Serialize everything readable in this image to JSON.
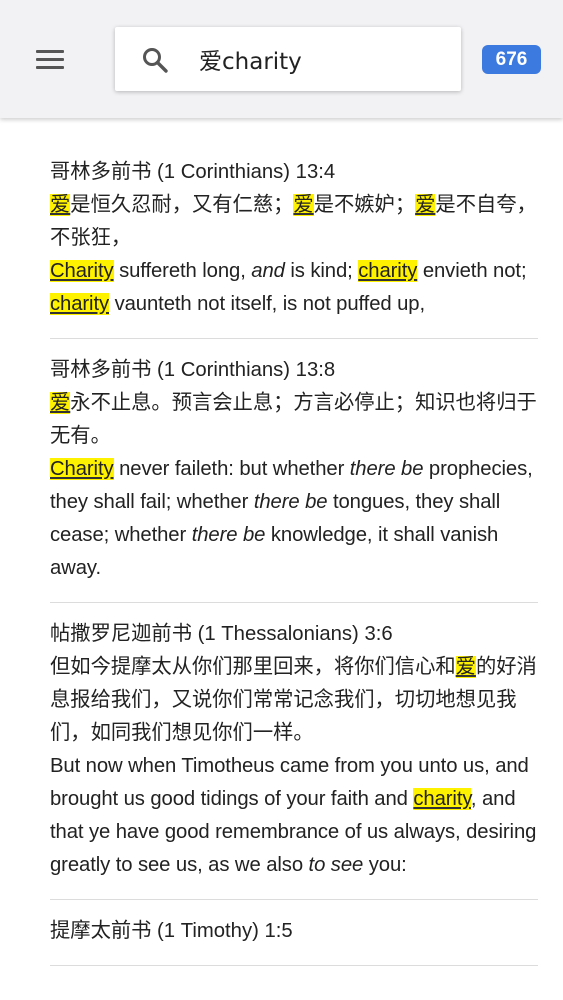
{
  "search": {
    "query": "爱charity"
  },
  "result_count": "676",
  "icons": {
    "menu": "hamburger-menu-icon",
    "search": "magnifier-search-icon"
  },
  "colors": {
    "highlight": "#fff200",
    "badge": "#3d7ae0",
    "topbar": "#f2f2f4"
  },
  "results": [
    {
      "reference": "哥林多前书 (1 Corinthians) 13:4",
      "chinese": [
        {
          "t": "爱",
          "hl": true
        },
        {
          "t": "是恒久忍耐，又有仁慈；"
        },
        {
          "t": "爱",
          "hl": true
        },
        {
          "t": "是不嫉妒；"
        },
        {
          "t": "爱",
          "hl": true
        },
        {
          "t": "是不自夸，不张狂，"
        }
      ],
      "english": [
        {
          "t": "Charity",
          "hl": true
        },
        {
          "t": " suffereth long, "
        },
        {
          "t": "and",
          "i": true
        },
        {
          "t": " is kind; "
        },
        {
          "t": "charity",
          "hl": true
        },
        {
          "t": " envi­eth not; "
        },
        {
          "t": "charity",
          "hl": true
        },
        {
          "t": " vaunteth not itself, is not puffed up,"
        }
      ]
    },
    {
      "reference": "哥林多前书 (1 Corinthians) 13:8",
      "chinese": [
        {
          "t": "爱",
          "hl": true
        },
        {
          "t": "永不止息。预言会止息；方言必停止；知识也将归于无有。"
        }
      ],
      "english": [
        {
          "t": "Charity",
          "hl": true
        },
        {
          "t": " never faileth: but whether "
        },
        {
          "t": "there be",
          "i": true
        },
        {
          "t": " prophecies, they shall fail; whether "
        },
        {
          "t": "there be",
          "i": true
        },
        {
          "t": " tongues, they shall cease; whether "
        },
        {
          "t": "there be",
          "i": true
        },
        {
          "t": " knowledge, it shall vanish away."
        }
      ]
    },
    {
      "reference": "帖撒罗尼迦前书 (1 Thessalonians) 3:6",
      "chinese": [
        {
          "t": "但如今提摩太从你们那里回来，将你们信心和"
        },
        {
          "t": "爱",
          "hl": true
        },
        {
          "t": "的好消息报给我们，又说你们常常记念我们，切切地想见我们，如同我们想见你们一样。"
        }
      ],
      "english": [
        {
          "t": "But now when Timotheus came from you unto us, and brought us good tidings of your faith and "
        },
        {
          "t": "charity",
          "hl": true
        },
        {
          "t": ", and that ye have good remem­brance of us always, desiring greatly to see us, as we also "
        },
        {
          "t": "to see",
          "i": true
        },
        {
          "t": " you:"
        }
      ]
    },
    {
      "reference": "提摩太前书 (1 Timothy) 1:5",
      "chinese": [],
      "english": []
    }
  ]
}
